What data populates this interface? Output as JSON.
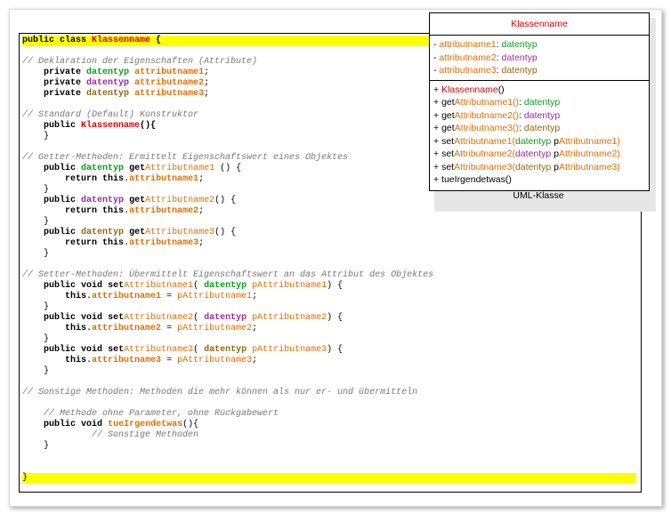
{
  "code": {
    "class_decl": "public class",
    "class_name": "Klassenname",
    "open_brace": " {",
    "comment_props": "// Deklaration der Eigenschaften (Attribute)",
    "kw_private": "private",
    "kw_public": "public",
    "kw_void": "void",
    "kw_return": "return",
    "kw_this": "this",
    "type": "datentyp",
    "attr1": "attributname1",
    "attr2": "attributname2",
    "attr3": "attributname3",
    "comment_ctor": "// Standard (Default) Konstruktor",
    "ctor_tail": "(){",
    "comment_getter": "// Getter-Methoden: Ermittelt Eigenschaftswert eines Objektes",
    "get_prefix": "get",
    "get1": "Attributname1",
    "get2": "Attributname2",
    "get3": "Attributname3",
    "comment_setter": "// Setter-Methoden: Übermittelt Eigenschaftswert an das Attribut des Objektes",
    "set_prefix": "set",
    "param1": "pAttributname1",
    "param2": "pAttributname2",
    "param3": "pAttributname3",
    "comment_other": "// Sonstige Methoden: Methoden die mehr können als nur er- und übermitteln",
    "comment_noparam": "// Methode ohne Parameter, ohne Rückgabewert",
    "method_name": "tueIrgendetwas",
    "comment_body": "// Sonstige Methoden",
    "close_brace": "}"
  },
  "uml": {
    "title": "Klassenname",
    "attributes": [
      {
        "prefix": "- ",
        "name": "attributname1",
        "sep": ": ",
        "type": "datentyp"
      },
      {
        "prefix": "- ",
        "name": "attributname2",
        "sep": ": ",
        "type": "datentyp"
      },
      {
        "prefix": "- ",
        "name": "attributname3",
        "sep": ": ",
        "type": "datentyp"
      }
    ],
    "methods": {
      "ctor": "+ Klassenname()",
      "plus": "+ ",
      "get": "get",
      "set": "set",
      "get1": "Attributname1()",
      "get2": "Attributname2()",
      "get3": "Attributname3()",
      "colon": ": ",
      "type": "datentyp",
      "s1": "Attributname1(",
      "s2": "Attributname2(",
      "s3": "Attributname3(",
      "p": "p",
      "pa1": "Attributname1)",
      "pa2": "Attributname2)",
      "pa3": "Attributname3)",
      "space": " ",
      "other": "+ tueIrgendetwas()"
    },
    "caption": "UML-Klasse"
  },
  "colors": {
    "highlight": "#ffff00",
    "class_name": "#e00000",
    "attribute": "#e07000",
    "type_1": "#0a9e1c",
    "type_2": "#9b2c9e",
    "type_3": "#8f6a10",
    "comment": "#777777"
  }
}
